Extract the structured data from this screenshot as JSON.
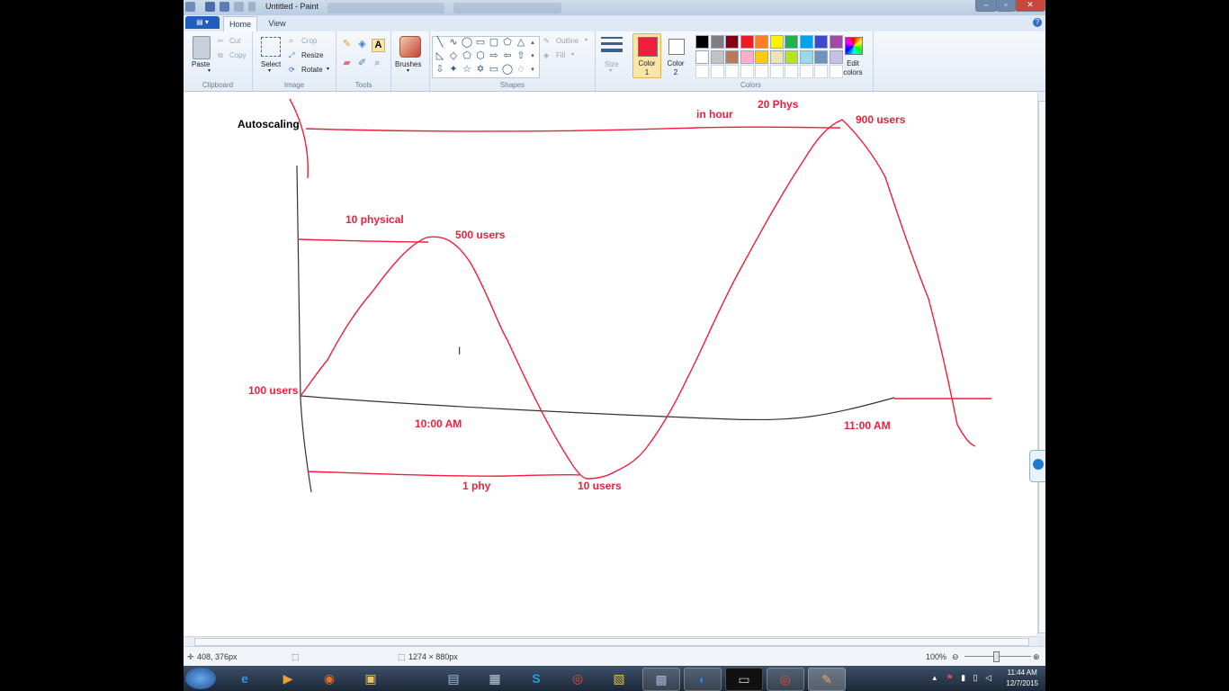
{
  "window": {
    "title": "Untitled - Paint"
  },
  "tabs": {
    "file": "▤ ▾",
    "home": "Home",
    "view": "View"
  },
  "clipboard": {
    "paste": "Paste",
    "cut": "Cut",
    "copy": "Copy",
    "label": "Clipboard"
  },
  "image": {
    "select": "Select",
    "crop": "Crop",
    "resize": "Resize",
    "rotate": "Rotate",
    "label": "Image"
  },
  "tools": {
    "label": "Tools",
    "brushes": "Brushes"
  },
  "shapes": {
    "outline": "Outline",
    "fill": "Fill",
    "label": "Shapes",
    "size": "Size"
  },
  "colors": {
    "color1": "Color 1",
    "color2": "Color 2",
    "edit": "Edit colors",
    "label": "Colors",
    "color1_value": "#ee1f3b",
    "color2_value": "#ffffff",
    "palette_row1": [
      "#000000",
      "#7f7f7f",
      "#880015",
      "#ed1c24",
      "#ff7f27",
      "#fff200",
      "#22b14c",
      "#00a2e8",
      "#3f48cc",
      "#a349a4"
    ],
    "palette_row2": [
      "#ffffff",
      "#c3c3c3",
      "#b97a57",
      "#ffaec9",
      "#ffc90e",
      "#efe4b0",
      "#b5e61d",
      "#99d9ea",
      "#7092be",
      "#c8bfe7"
    ]
  },
  "canvas": {
    "texts": {
      "autoscaling": "Autoscaling",
      "in_hour": "in hour",
      "twenty_phys": "20 Phys",
      "nine_hundred": "900 users",
      "ten_physical": "10 physical",
      "five_hundred": "500 users",
      "hundred_users": "100 users",
      "ten_am": "10:00 AM",
      "eleven_am": "11:00 AM",
      "one_phy": "1 phy",
      "ten_users": "10 users"
    },
    "ink_color": "#ee1f3b",
    "axis_color": "#333333"
  },
  "statusbar": {
    "cursor": "408, 376px",
    "size": "1274 × 880px",
    "zoom": "100%"
  },
  "taskbar": {
    "time": "11:44 AM",
    "date": "12/7/2015"
  }
}
